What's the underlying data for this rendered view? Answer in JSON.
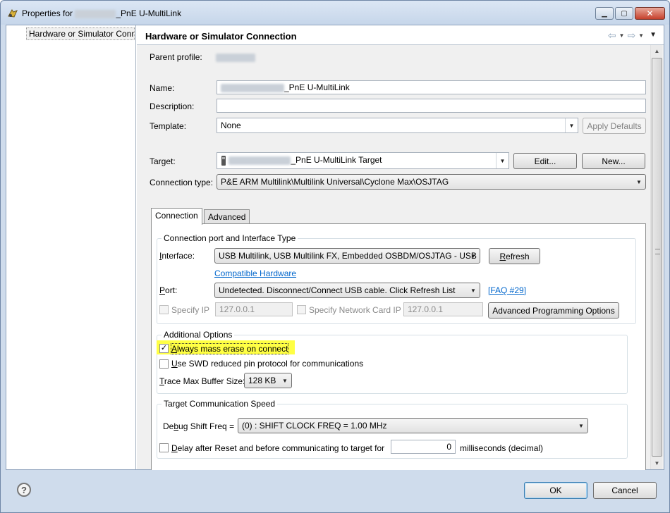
{
  "window": {
    "title_prefix": "Properties for",
    "title_suffix": "_PnE U-MultiLink"
  },
  "tree": {
    "items": [
      {
        "label": "Hardware or Simulator Conn"
      }
    ]
  },
  "header": {
    "title": "Hardware or Simulator Connection"
  },
  "form": {
    "parent_profile_label": "Parent profile:",
    "name_label": "Name:",
    "name_value_suffix": "_PnE U-MultiLink",
    "description_label": "Description:",
    "description_value": "",
    "template_label": "Template:",
    "template_value": "None",
    "apply_defaults_label": "Apply Defaults",
    "target_label": "Target:",
    "target_value_suffix": "_PnE U-MultiLink Target",
    "edit_label": "Edit...",
    "new_label": "New...",
    "connection_type_label": "Connection type:",
    "connection_type_value": "P&E ARM Multilink\\Multilink Universal\\Cyclone Max\\OSJTAG"
  },
  "tabs": [
    {
      "label": "Connection",
      "active": true
    },
    {
      "label": "Advanced",
      "active": false
    }
  ],
  "connection_port": {
    "group_title": "Connection port and Interface Type",
    "interface_label": "Interface:",
    "interface_value": "USB Multilink, USB Multilink FX, Embedded OSBDM/OSJTAG - USB",
    "refresh_label": "Refresh",
    "compatible_hardware_link": "Compatible Hardware",
    "port_label": "Port:",
    "port_value": "Undetected. Disconnect/Connect USB cable. Click Refresh List",
    "faq_link": "[FAQ #29]",
    "specify_ip_label": "Specify IP",
    "ip_value": "127.0.0.1",
    "specify_network_card_label": "Specify Network Card IP",
    "network_card_ip_value": "127.0.0.1",
    "advanced_programming_label": "Advanced Programming Options"
  },
  "additional_options": {
    "group_title": "Additional Options",
    "mass_erase_label": "Always mass erase on connect",
    "mass_erase_checked": true,
    "swd_label": "Use SWD reduced pin protocol for communications",
    "swd_checked": false,
    "trace_label": "Trace Max Buffer Size:",
    "trace_value": "128 KB"
  },
  "target_comm": {
    "group_title": "Target Communication Speed",
    "debug_shift_label": "Debug Shift Freq =",
    "debug_shift_value": "(0) : SHIFT CLOCK FREQ = 1.00 MHz",
    "delay_label": "Delay after Reset and before communicating to target for",
    "delay_value": "0",
    "delay_unit": "milliseconds (decimal)"
  },
  "footer": {
    "ok_label": "OK",
    "cancel_label": "Cancel",
    "help_glyph": "?"
  },
  "icons": {
    "check_glyph": "✓",
    "dropdown_glyph": "▼",
    "close_glyph": "✕",
    "minimize_glyph": "▁",
    "maximize_glyph": "▢",
    "back_glyph": "⇦",
    "forward_glyph": "⇨"
  }
}
